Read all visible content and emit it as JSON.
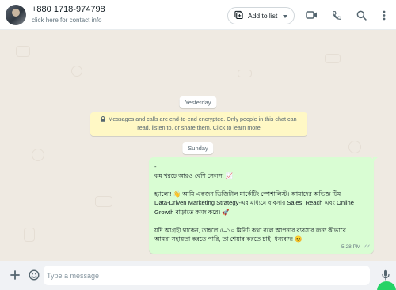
{
  "header": {
    "contact_name": "+880 1718-974798",
    "contact_subtitle": "click here for contact info",
    "add_to_list_label": "Add to list",
    "icons": [
      "video-call-icon",
      "voice-call-icon",
      "search-icon",
      "menu-icon"
    ]
  },
  "chat": {
    "date_yesterday": "Yesterday",
    "encryption_line1": "Messages and calls are end-to-end encrypted. Only people in this chat can",
    "encryption_line2": "read, listen to, or share them. Click to learn more",
    "date_sunday": "Sunday",
    "message": {
      "line0": "-",
      "line1": "কম খরচে আরও বেশি সেলস! 📈",
      "line2": "হ্যালো! 👋 আমি একজন ডিজিটাল মার্কেটিং স্পেশালিস্ট। আমাদের অভিজ্ঞ টিম",
      "line3": "Data-Driven Marketing Strategy-এর মাধ্যমে ব্যবসার Sales, Reach এবং Online",
      "line4": "Growth বাড়াতে কাজ করে। 🚀",
      "line5": "যদি আগ্রহী থাকেন, তাহলে ৫–১০ মিনিট কথা বলে আপনার ব্যবসার জন্য কীভাবে",
      "line6": "আমরা সহায়তা করতে পারি, তা শেয়ার করতে চাই। ধন্যবাদ! 😊",
      "time": "5:28 PM",
      "status": "read"
    }
  },
  "composer": {
    "placeholder": "Type a message"
  },
  "colors": {
    "outgoing_bubble": "#d9fdd3",
    "chat_bg": "#efeae2",
    "encryption_bg": "#fff8c5",
    "accent": "#25d366"
  }
}
